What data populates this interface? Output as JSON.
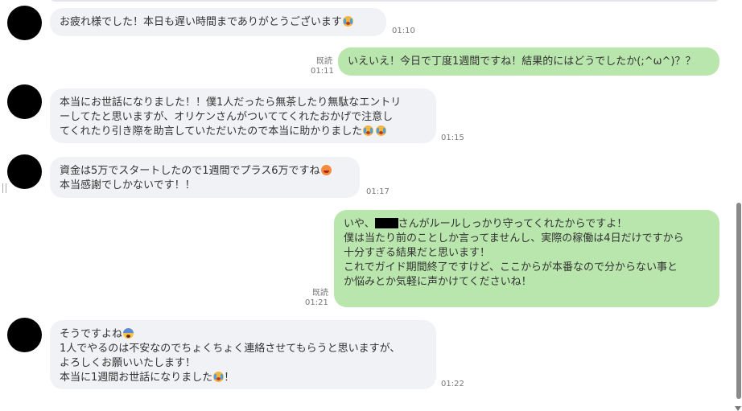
{
  "messages": [
    {
      "id": "m1",
      "side": "in",
      "text": "お疲れ様でした！本日も遅い時間までありがとうございます",
      "emoji_after": [
        "crying-face-icon"
      ],
      "time": "01:10"
    },
    {
      "id": "m2",
      "side": "out",
      "text": "いえいえ！今日で丁度1週間ですね！結果的にはどうでしたか(;^ω^)？？",
      "read": "既読",
      "time": "01:11"
    },
    {
      "id": "m3",
      "side": "in",
      "lines": [
        "本当にお世話になりました！！僕1人だったら無茶したり無駄なエントリ",
        "ーしてたと思いますが、オリケンさんがついててくれたおかげで注意し",
        "てくれたり引き際を助言していただいたので本当に助かりました"
      ],
      "emoji_after": [
        "crying-face-icon",
        "crying-face-icon"
      ],
      "time": "01:15"
    },
    {
      "id": "m4",
      "side": "in",
      "lines": [
        "資金は5万でスタートしたので1週間でプラス6万ですね",
        "本当感謝でしかないです！！"
      ],
      "emoji_after": [
        "hot-face-icon"
      ],
      "time": "01:17"
    },
    {
      "id": "m5",
      "side": "out",
      "line1_pre": "いや、",
      "line1_post": "さんがルールしっかり守ってくれたからですよ！",
      "lines": [
        "僕は当たり前のことしか言ってませんし、実際の稼働は4日だけですから",
        "十分すぎる結果だと思います！",
        "これでガイド期間終了ですけど、ここからが本番なので分からない事と",
        "か悩みとか気軽に声かけてくださいね！"
      ],
      "read": "既読",
      "time": "01:21"
    },
    {
      "id": "m6",
      "side": "in",
      "line1": "そうですよね",
      "lines": [
        "1人でやるのは不安なのでちょくちょく連絡させてもらうと思いますが、",
        "よろしくお願いいたします！"
      ],
      "line_last_pre": "本当に1週間お世話になりました",
      "line_last_post": "！",
      "time": "01:22"
    }
  ]
}
